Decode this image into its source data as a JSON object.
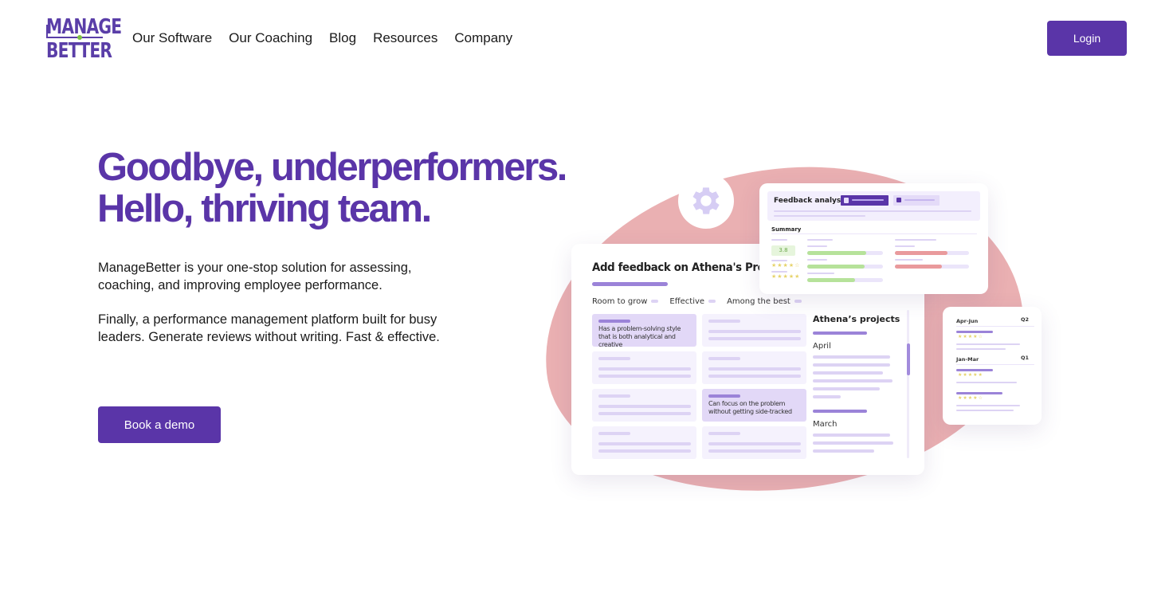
{
  "brand": {
    "logo_line1": "MANAGE",
    "logo_line2": "BETTER",
    "primary_color": "#5a35a8",
    "accent_dot_color": "#7cc043"
  },
  "nav": {
    "items": [
      {
        "label": "Our Software"
      },
      {
        "label": "Our Coaching"
      },
      {
        "label": "Blog"
      },
      {
        "label": "Resources"
      },
      {
        "label": "Company"
      }
    ],
    "login_label": "Login"
  },
  "hero": {
    "title_line1": "Goodbye, underperformers.",
    "title_line2": "Hello, thriving team.",
    "paragraph1": "ManageBetter is your one-stop solution for assessing, coaching, and improving employee performance.",
    "paragraph2": "Finally, a performance management platform built for busy leaders. Generate reviews without writing.  Fast & effective.",
    "cta_label": "Book a demo"
  },
  "illustration": {
    "main_card": {
      "title": "Add feedback on Athena's Proble",
      "ratings": [
        "Room to grow",
        "Effective",
        "Among the best"
      ],
      "selected_tiles": [
        "Has a problem-solving style that is both analytical and creative",
        "Can focus on the problem without getting side-tracked"
      ],
      "projects_title": "Athena’s projects",
      "months": [
        "April",
        "March"
      ]
    },
    "feedback_card": {
      "title": "Feedback analysis",
      "summary_label": "Summary",
      "score": "3.8",
      "stars_row1": "★★★★☆",
      "stars_row2": "★★★★★"
    },
    "quarter_card": {
      "periods": [
        {
          "range": "Apr-Jun",
          "quarter": "Q2",
          "stars": "★★★★☆"
        },
        {
          "range": "Jan-Mar",
          "quarter": "Q1",
          "stars": "★★★★★"
        }
      ],
      "extra_stars": "★★★★☆"
    }
  }
}
